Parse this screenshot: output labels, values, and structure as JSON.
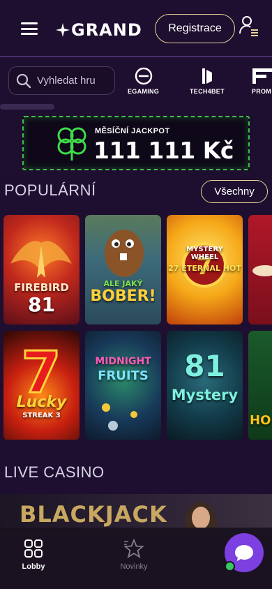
{
  "header": {
    "logo_text": "GRAND",
    "register_label": "Registrace"
  },
  "search": {
    "placeholder": "Vyhledat hru"
  },
  "providers": [
    {
      "label": "EGAMING"
    },
    {
      "label": "TECH4BET"
    },
    {
      "label": "PROM"
    }
  ],
  "jackpot": {
    "title": "MĚSÍČNÍ JACKPOT",
    "amount": "111 111 Kč"
  },
  "popular": {
    "title": "POPULÁRNÍ",
    "all_label": "Všechny",
    "games": [
      {
        "title_line1": "FIREBIRD",
        "title_line2": "81"
      },
      {
        "title_line1": "ALE JAKÝ",
        "title_line2": "BOBER!"
      },
      {
        "title_line1": "MYSTERY WHEEL",
        "title_line2": "27 ETERNAL HOT"
      },
      {
        "title_line1": "",
        "title_line2": ""
      },
      {
        "title_line1": "Lucky",
        "title_line2": "STREAK 3"
      },
      {
        "title_line1": "MIDNIGHT",
        "title_line2": "FRUITS"
      },
      {
        "title_line1": "81",
        "title_line2": "Mystery"
      },
      {
        "title_line1": "HO",
        "title_line2": ""
      }
    ]
  },
  "live_casino": {
    "title": "LIVE CASINO",
    "banner_text": "BLACKJACK"
  },
  "bottom_nav": {
    "items": [
      {
        "label": "Lobby",
        "active": true
      },
      {
        "label": "Novinky",
        "active": false
      }
    ]
  },
  "colors": {
    "background": "#1e0f30",
    "accent_gold": "#e8d39a",
    "jackpot_green": "#3fbf4a",
    "chat_purple": "#7c3fe0",
    "online_green": "#35c860"
  },
  "icons": {
    "menu": "hamburger-icon",
    "user": "user-menu-icon",
    "search": "search-icon",
    "lobby": "grid-icon",
    "news": "star-icon",
    "chat": "chat-bubble-icon"
  }
}
